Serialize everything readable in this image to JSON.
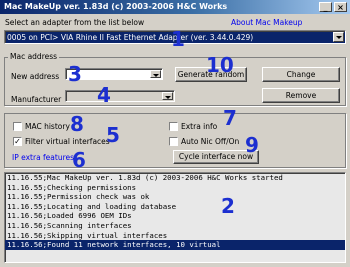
{
  "window": {
    "title": "Mac MakeUp ver. 1.83d (c) 2003-2006 H&C Works"
  },
  "adapter": {
    "prompt": "Select an adapter from the list below",
    "about_link": "About Mac Makeup",
    "selected": "0005 on PCI> VIA Rhine II Fast Ethernet Adapter (ver. 3.44.0.429)"
  },
  "mac_address": {
    "group_title": "Mac address",
    "new_address_label": "New address",
    "new_address_value": "",
    "manufacturer_label": "Manufacturer",
    "manufacturer_value": "",
    "generate_button": "Generate random",
    "change_button": "Change",
    "remove_button": "Remove"
  },
  "options": {
    "mac_history": {
      "label": "MAC history",
      "checked": false
    },
    "filter_virtual": {
      "label": "Filter virtual interfaces",
      "checked": true
    },
    "extra_info": {
      "label": "Extra info",
      "checked": false
    },
    "auto_nic": {
      "label": "Auto Nic Off/On",
      "checked": false
    },
    "ip_extra_link": "IP extra features",
    "cycle_button": "Cycle interface now"
  },
  "log": [
    "11.16.55;Mac MakeUp ver. 1.83d (c) 2003-2006 H&C Works started",
    "11.16.55;Checking permissions",
    "11.16.55;Permission check was ok",
    "11.16.55;Locating and loading database",
    "11.16.56;Loaded 6996 OEM IDs",
    "11.16.56;Scanning interfaces",
    "11.16.56;Skipping virtual interfaces",
    "11.16.56;Found 11 network interfaces, 10 virtual"
  ],
  "log_selected_index": 7,
  "annotations": [
    "1",
    "2",
    "3",
    "4",
    "5",
    "6",
    "7",
    "8",
    "9",
    "10"
  ]
}
